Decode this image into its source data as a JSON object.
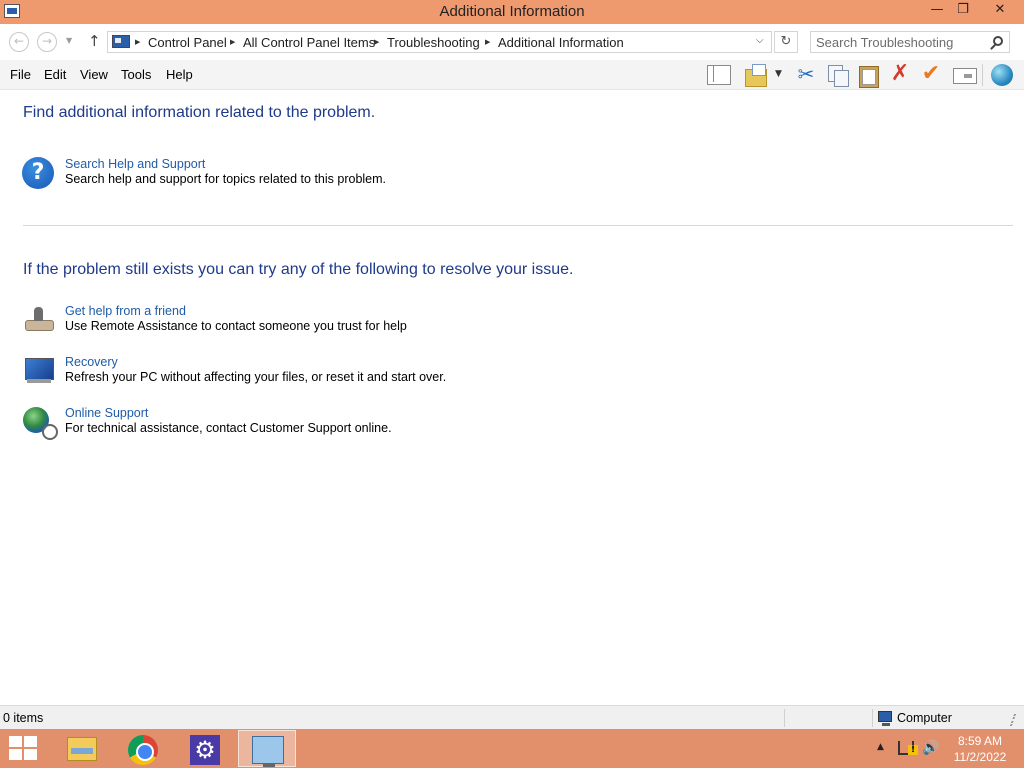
{
  "window": {
    "title": "Additional Information",
    "controls": {
      "minimize": "—",
      "maximize": "❐",
      "close": "✕"
    }
  },
  "address_bar": {
    "breadcrumb": [
      "Control Panel",
      "All Control Panel Items",
      "Troubleshooting",
      "Additional Information"
    ],
    "search_placeholder": "Search Troubleshooting"
  },
  "menu": {
    "items": [
      "File",
      "Edit",
      "View",
      "Tools",
      "Help"
    ]
  },
  "toolbar": {
    "icons": [
      "layout-icon",
      "folder-options-icon",
      "cut-icon",
      "copy-icon",
      "paste-icon",
      "delete-icon",
      "check-icon",
      "properties-icon",
      "globe-icon"
    ]
  },
  "content": {
    "section1_heading": "Find additional information related to the problem.",
    "section1_tasks": [
      {
        "icon": "help-icon",
        "title": "Search Help and Support",
        "description": "Search help and support for topics related to this problem."
      }
    ],
    "section2_heading": "If the problem still exists you can try any of the following to resolve your issue.",
    "section2_tasks": [
      {
        "icon": "remote-assistance-icon",
        "title": "Get help from a friend",
        "description": "Use Remote Assistance to contact someone you trust for help"
      },
      {
        "icon": "recovery-icon",
        "title": "Recovery",
        "description": "Refresh your PC without affecting your files, or reset it and start over."
      },
      {
        "icon": "online-support-icon",
        "title": "Online Support",
        "description": "For technical assistance, contact Customer Support online."
      }
    ]
  },
  "status_bar": {
    "items_count": "0 items",
    "location": "Computer"
  },
  "taskbar": {
    "apps": [
      "file-explorer",
      "google-chrome",
      "settings",
      "control-panel"
    ],
    "active_app": "control-panel",
    "clock_time": "8:59 AM",
    "clock_date": "11/2/2022"
  },
  "colors": {
    "titlebar": "#ef9a6e",
    "taskbar": "#e28f6b",
    "heading": "#1e3a8a",
    "link": "#1f5ca8"
  }
}
